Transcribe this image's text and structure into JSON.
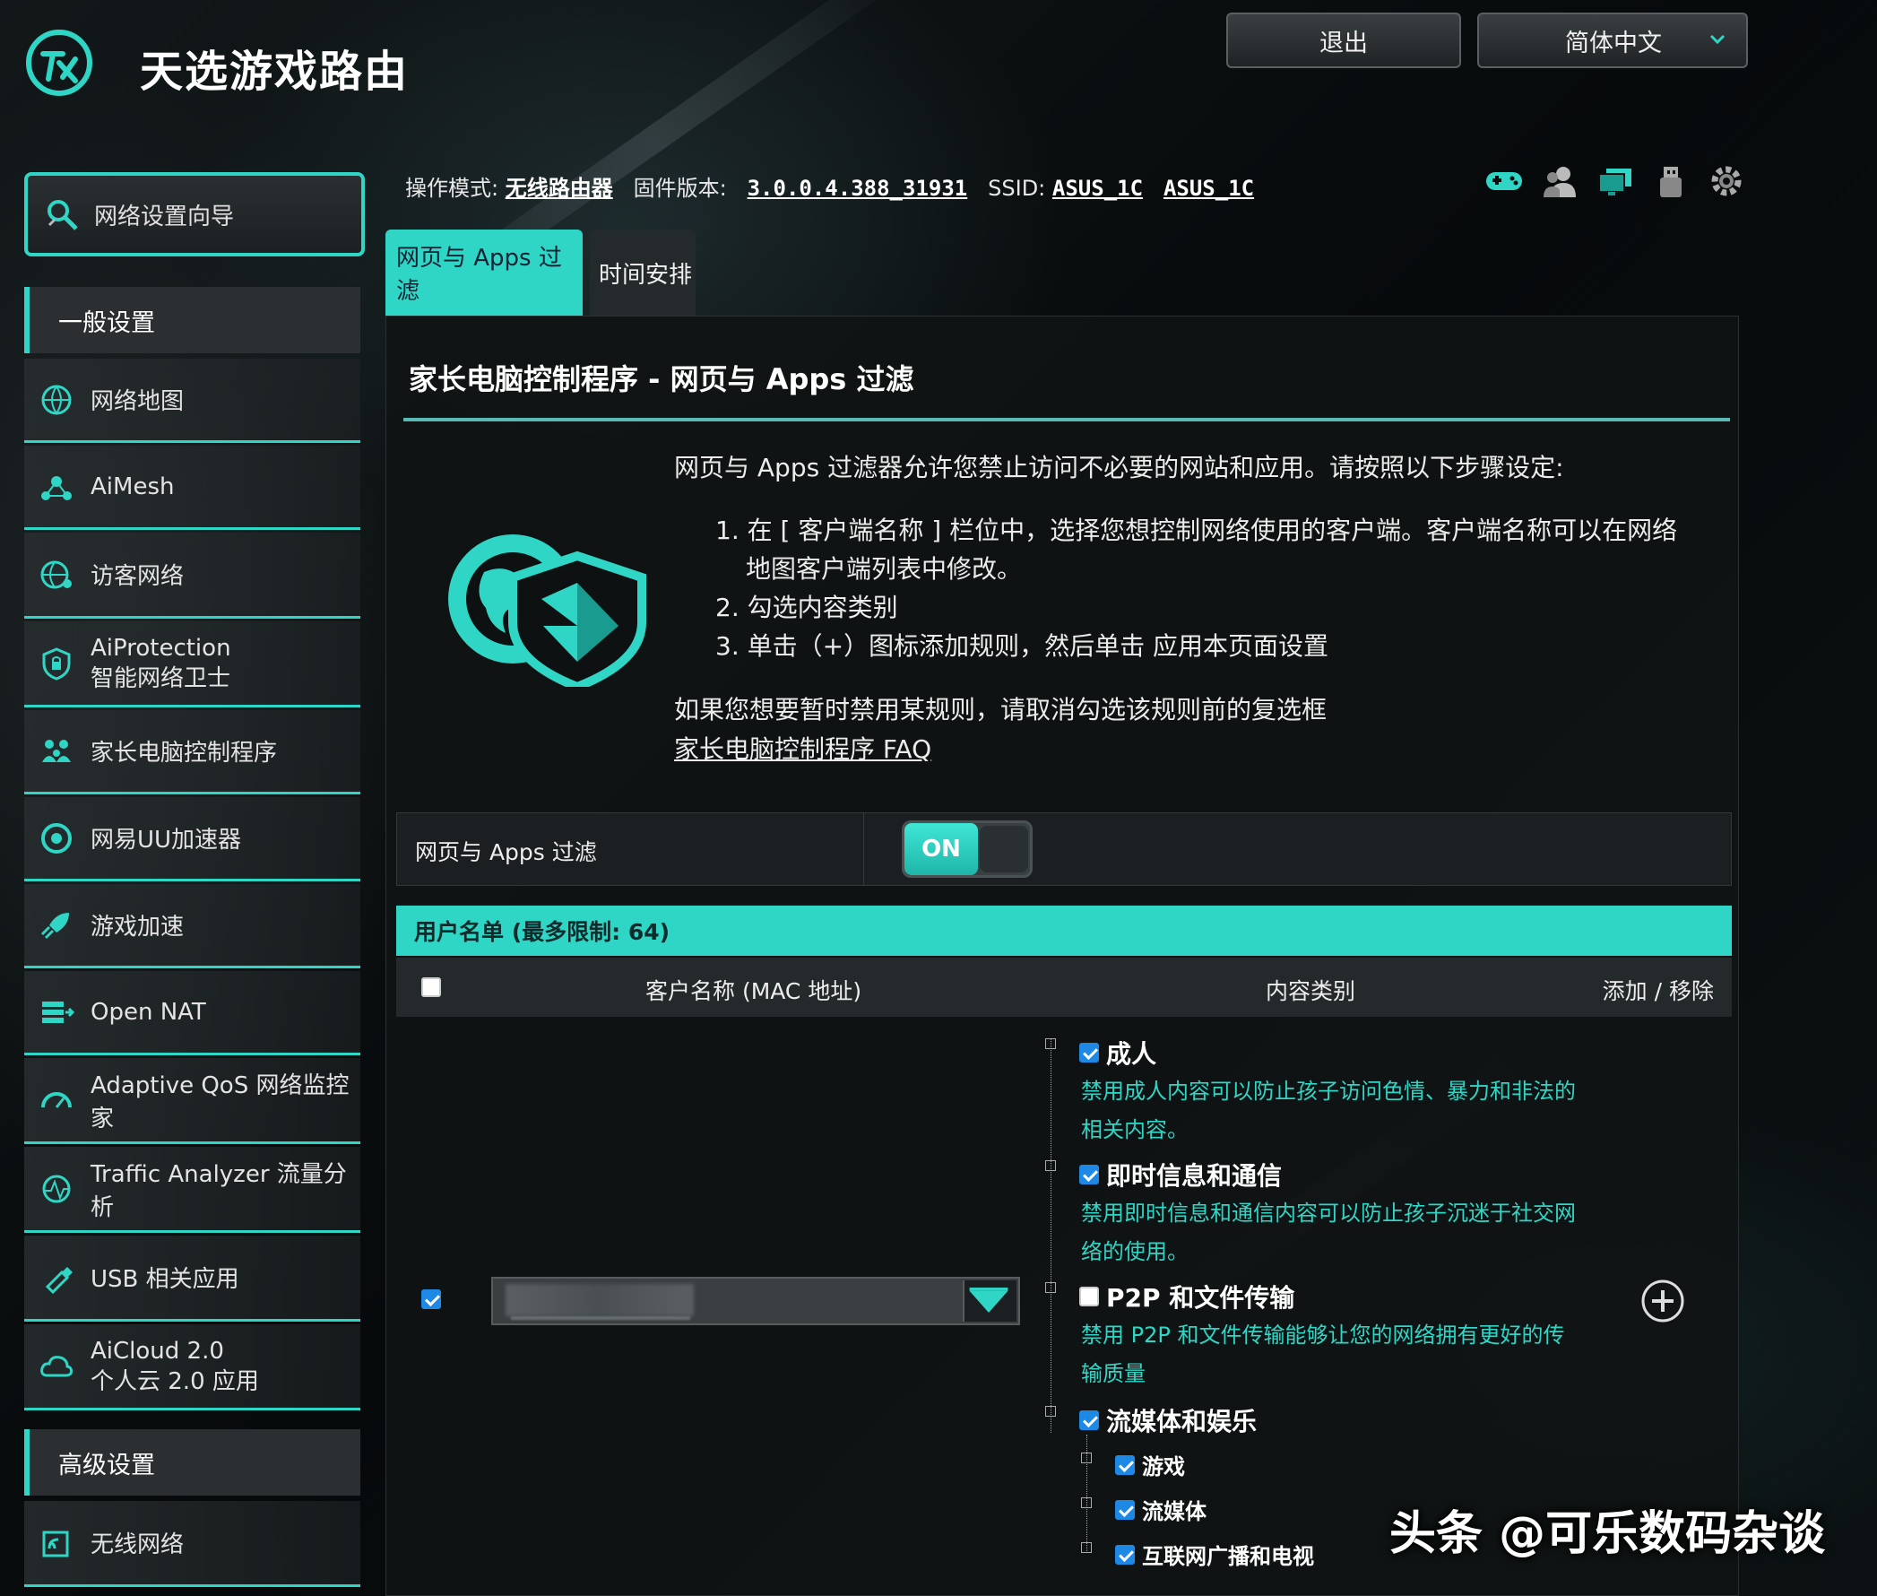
{
  "brand": {
    "title": "天选游戏路由",
    "logo_icon": "tx-logo-icon"
  },
  "header": {
    "logout_label": "退出",
    "language_label": "简体中文"
  },
  "status": {
    "mode_label": "操作模式:",
    "mode_value": "无线路由器",
    "firmware_label": "固件版本:",
    "firmware_value": "3.0.0.4.388_31931",
    "ssid_label": "SSID:",
    "ssid_1": "ASUS_1C",
    "ssid_2": "ASUS_1C",
    "icons": [
      "gamepad-icon",
      "users-icon",
      "monitor-icon",
      "usb-icon",
      "settings-gear-icon"
    ]
  },
  "sidebar": {
    "wizard_label": "网络设置向导",
    "general_section": "一般设置",
    "advanced_section": "高级设置",
    "items": [
      {
        "label": "网络地图",
        "icon": "globe-network-icon"
      },
      {
        "label": "AiMesh",
        "icon": "mesh-icon"
      },
      {
        "label": "访客网络",
        "icon": "guest-globe-icon"
      },
      {
        "label": "AiProtection",
        "label2": "智能网络卫士",
        "icon": "shield-lock-icon"
      },
      {
        "label": "家长电脑控制程序",
        "icon": "family-icon"
      },
      {
        "label": "网易UU加速器",
        "icon": "uu-accelerator-icon"
      },
      {
        "label": "游戏加速",
        "icon": "rocket-icon"
      },
      {
        "label": "Open NAT",
        "icon": "open-nat-icon"
      },
      {
        "label": "Adaptive QoS 网络监控家",
        "icon": "gauge-icon"
      },
      {
        "label": "Traffic Analyzer 流量分析",
        "icon": "traffic-analyzer-icon"
      },
      {
        "label": "USB 相关应用",
        "icon": "usb-app-icon"
      },
      {
        "label": "AiCloud 2.0",
        "label2": "个人云 2.0 应用",
        "icon": "cloud-icon"
      }
    ],
    "advanced_items": [
      {
        "label": "无线网络",
        "icon": "wireless-icon"
      }
    ]
  },
  "tabs": [
    {
      "label": "网页与 Apps 过滤",
      "active": true
    },
    {
      "label": "时间安排",
      "active": false
    }
  ],
  "main": {
    "title": "家长电脑控制程序 - 网页与 Apps 过滤",
    "intro": "网页与 Apps 过滤器允许您禁止访问不必要的网站和应用。请按照以下步骤设定:",
    "step1_a": "1. 在 [ 客户端名称 ] 栏位中，选择您想控制网络使用的客户端。客户端名称可以在网络",
    "step1_b": "地图客户端列表中修改。",
    "step2": "2. 勾选内容类别",
    "step3": "3. 单击（+）图标添加规则，然后单击 应用本页面设置",
    "note": "如果您想要暂时禁用某规则，请取消勾选该规则前的复选框",
    "faq_link": "家长电脑控制程序 FAQ",
    "toggle_label": "网页与 Apps 过滤",
    "toggle_state": "ON",
    "list_title": "用户名单 (最多限制:  64)",
    "col_client": "客户名称 (MAC 地址)",
    "col_category": "内容类别",
    "col_add_remove": "添加 / 移除"
  },
  "categories": {
    "adult": {
      "label": "成人",
      "checked": true,
      "desc": "禁用成人内容可以防止孩子访问色情、暴力和非法的相关内容。"
    },
    "im": {
      "label": "即时信息和通信",
      "checked": true,
      "desc": "禁用即时信息和通信内容可以防止孩子沉迷于社交网络的使用。"
    },
    "p2p": {
      "label": "P2P 和文件传输",
      "checked": false,
      "desc": "禁用 P2P 和文件传输能够让您的网络拥有更好的传输质量"
    },
    "streaming": {
      "label": "流媒体和娱乐",
      "checked": true
    },
    "games": {
      "label": "游戏",
      "checked": true
    },
    "media": {
      "label": "流媒体",
      "checked": true
    },
    "tv": {
      "label": "互联网广播和电视",
      "checked": true
    }
  },
  "watermark": "头条 @可乐数码杂谈",
  "colors": {
    "accent": "#2fd6c6",
    "checkbox": "#1e88e5",
    "background": "#0a0d0e"
  }
}
